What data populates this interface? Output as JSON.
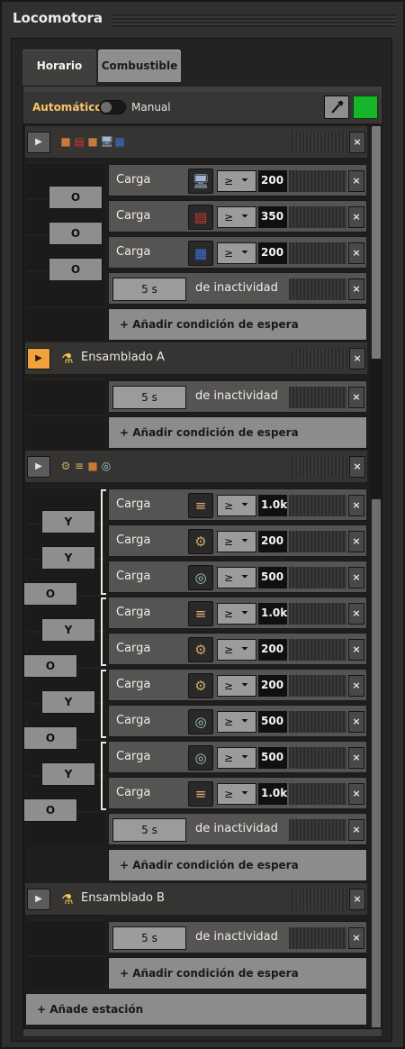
{
  "window": {
    "title": "Locomotora"
  },
  "tabs": [
    {
      "label": "Horario",
      "active": true
    },
    {
      "label": "Combustible",
      "active": false
    }
  ],
  "mode": {
    "automatic_label": "Automático",
    "manual_label": "Manual",
    "selected": "automatic"
  },
  "colors": {
    "accent": "#f0a33a",
    "green": "#16b52a",
    "panel": "#403f3e"
  },
  "stations": [
    {
      "name": "",
      "icons": [
        "mixed-items-icon"
      ],
      "active": false,
      "conditions": [
        {
          "logic": "O",
          "label": "Carga",
          "item_icon": "advanced-circuit-icon",
          "comparator": "≥",
          "value": "200"
        },
        {
          "logic": "O",
          "label": "Carga",
          "item_icon": "electronic-circuit-red-icon",
          "comparator": "≥",
          "value": "350"
        },
        {
          "logic": "O",
          "label": "Carga",
          "item_icon": "processing-unit-icon",
          "comparator": "≥",
          "value": "200"
        }
      ],
      "wait": {
        "value": "5 s",
        "label": "de inactividad"
      },
      "add_condition": "+ Añadir condición de espera"
    },
    {
      "name": "Ensamblado A",
      "icons": [
        "flask-icon"
      ],
      "active": true,
      "wait": {
        "value": "5 s",
        "label": "de inactividad"
      },
      "add_condition": "+ Añadir condición de espera"
    },
    {
      "name": "",
      "icons": [
        "mixed-items-icon"
      ],
      "active": false,
      "conditions": [
        {
          "label": "Carga",
          "item_icon": "gear-stack-icon",
          "comparator": "≥",
          "value": "1.0k"
        },
        {
          "logic": "Y",
          "label": "Carga",
          "item_icon": "pipe-icon",
          "comparator": "≥",
          "value": "200"
        },
        {
          "logic": "Y",
          "label": "Carga",
          "item_icon": "engine-icon",
          "comparator": "≥",
          "value": "500"
        },
        {
          "logic": "O",
          "label": "Carga",
          "item_icon": "gear-stack-icon",
          "comparator": "≥",
          "value": "1.0k"
        },
        {
          "logic": "Y",
          "label": "Carga",
          "item_icon": "pipe-icon",
          "comparator": "≥",
          "value": "200"
        },
        {
          "logic": "O",
          "label": "Carga",
          "item_icon": "pipe-icon",
          "comparator": "≥",
          "value": "200"
        },
        {
          "logic": "Y",
          "label": "Carga",
          "item_icon": "engine-icon",
          "comparator": "≥",
          "value": "500"
        },
        {
          "logic": "O",
          "label": "Carga",
          "item_icon": "engine-icon",
          "comparator": "≥",
          "value": "500"
        },
        {
          "logic": "Y",
          "label": "Carga",
          "item_icon": "gear-stack-icon",
          "comparator": "≥",
          "value": "1.0k"
        }
      ],
      "final_logic": "O",
      "wait": {
        "value": "5 s",
        "label": "de inactividad"
      },
      "add_condition": "+ Añadir condición de espera"
    },
    {
      "name": "Ensamblado B",
      "icons": [
        "flask-icon"
      ],
      "active": false,
      "wait": {
        "value": "5 s",
        "label": "de inactividad"
      },
      "add_condition": "+ Añadir condición de espera"
    }
  ],
  "add_station": "+ Añade estación",
  "glyphs": {
    "play": "▶",
    "close": "×",
    "dropdown": "⏷"
  }
}
